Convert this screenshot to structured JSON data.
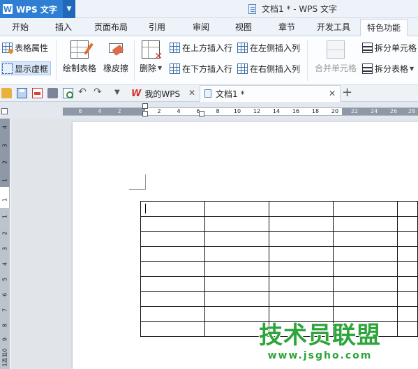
{
  "titlebar": {
    "app_name": "WPS 文字",
    "app_logo": "W",
    "doc_title": "文档1 * - WPS 文字"
  },
  "menu": {
    "tabs": [
      "开始",
      "插入",
      "页面布局",
      "引用",
      "审阅",
      "视图",
      "章节",
      "开发工具",
      "特色功能"
    ],
    "active": "特色功能"
  },
  "ribbon": {
    "table_properties": "表格属性",
    "show_gridlines": "显示虚框",
    "draw_table": "绘制表格",
    "eraser": "橡皮擦",
    "delete": "删除",
    "insert_row_above": "在上方插入行",
    "insert_row_below": "在下方插入行",
    "insert_col_left": "在左侧插入列",
    "insert_col_right": "在右侧插入列",
    "merge_cells": "合并单元格",
    "split_cells": "拆分单元格",
    "split_table": "拆分表格"
  },
  "doc_tabs": {
    "my_wps": "我的WPS",
    "doc1": "文档1 *"
  },
  "ruler": {
    "h_ticks": [
      "6",
      "4",
      "2",
      "2",
      "4",
      "6",
      "8",
      "10",
      "12",
      "14",
      "16",
      "18",
      "20",
      "22",
      "24",
      "26",
      "28"
    ],
    "v_ticks": [
      "4",
      "3",
      "2",
      "1",
      "1",
      "1",
      "2",
      "3",
      "4",
      "5",
      "6",
      "7",
      "8",
      "9",
      "10",
      "11",
      "12"
    ]
  },
  "table": {
    "rows": 9,
    "cols": 5
  },
  "watermark": {
    "main": "技术员联盟",
    "url": "www.jsgho.com"
  },
  "icons": [
    "table-properties-icon",
    "show-gridlines-icon",
    "draw-table-icon",
    "eraser-icon",
    "delete-table-icon",
    "insert-row-above-icon",
    "insert-row-below-icon",
    "insert-col-left-icon",
    "insert-col-right-icon",
    "merge-cells-icon",
    "split-cells-icon",
    "split-table-icon",
    "open-icon",
    "save-icon",
    "export-pdf-icon",
    "print-icon",
    "print-preview-icon",
    "undo-icon",
    "redo-icon",
    "customize-caret-icon",
    "new-tab-icon"
  ]
}
